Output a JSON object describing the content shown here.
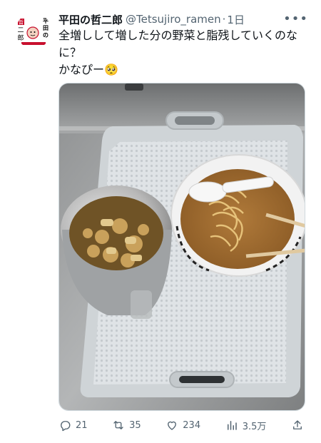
{
  "tweet": {
    "display_name": "平田の哲二郎",
    "handle": "@Tetsujiro_ramen",
    "separator": "·",
    "time": "1日",
    "more_label": "•••",
    "text_line1": "全増しして増した分の野菜と脂残していくのな",
    "text_line2": "に？",
    "text_line3": "かなぴー🥺",
    "avatar_text": "平田の二郎"
  },
  "actions": {
    "reply_count": "21",
    "retweet_count": "35",
    "like_count": "234",
    "views_count": "3.5万"
  },
  "colors": {
    "text": "#0f1419",
    "muted": "#536471",
    "avatar_red": "#c8102e"
  }
}
